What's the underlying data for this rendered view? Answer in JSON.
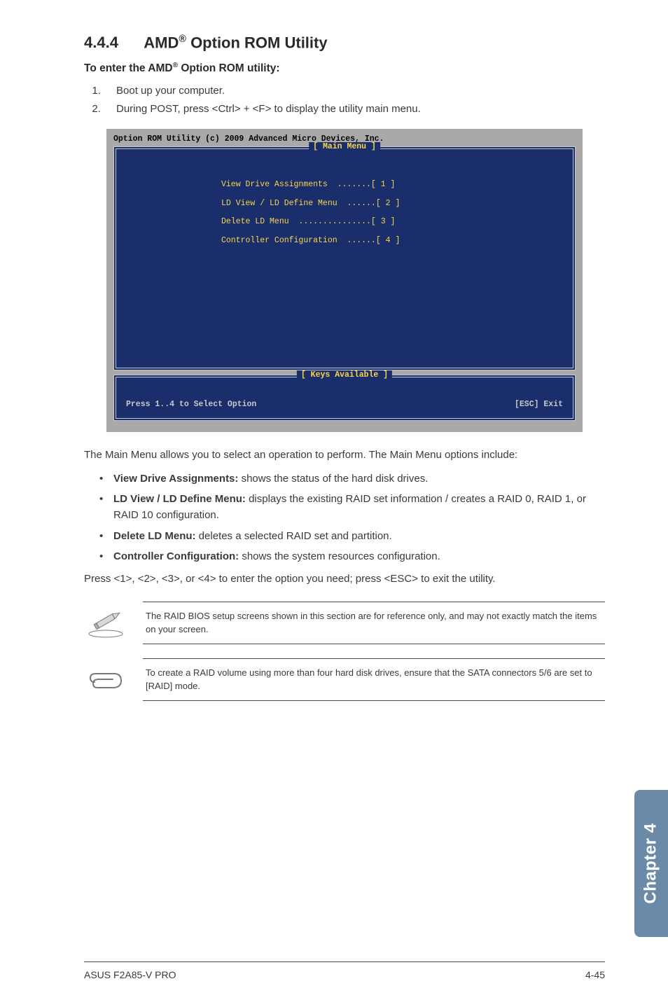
{
  "section": {
    "number": "4.4.4",
    "title_prefix": "AMD",
    "title_sup": "®",
    "title_rest": " Option ROM Utility"
  },
  "subhead_prefix": "To enter the AMD",
  "subhead_sup": "®",
  "subhead_rest": " Option ROM utility:",
  "steps": [
    "Boot up your computer.",
    "During POST, press <Ctrl> + <F> to display the utility main menu."
  ],
  "bios": {
    "header": "Option ROM Utility (c) 2009 Advanced Micro Devices, Inc.",
    "main_label": "[ Main Menu ]",
    "menu": [
      "View Drive Assignments  .......[ 1 ]",
      "LD View / LD Define Menu  ......[ 2 ]",
      "Delete LD Menu  ...............[ 3 ]",
      "Controller Configuration  ......[ 4 ]"
    ],
    "keys_label": "[ Keys Available ]",
    "press_left": "Press 1..4 to Select Option",
    "press_right": "[ESC] Exit"
  },
  "intro_para": "The Main Menu allows you to select an operation to perform. The Main Menu options include:",
  "bullets": [
    {
      "bold": "View Drive Assignments:",
      "rest": " shows the status of the hard disk drives."
    },
    {
      "bold": "LD View / LD Define Menu:",
      "rest": " displays the existing RAID set information / creates a RAID 0, RAID 1, or RAID 10 configuration."
    },
    {
      "bold": "Delete LD Menu:",
      "rest": " deletes a selected RAID set and partition."
    },
    {
      "bold": "Controller Configuration:",
      "rest": " shows the system resources configuration."
    }
  ],
  "press_para": "Press <1>, <2>, <3>, or <4> to enter the option you need; press <ESC> to exit the utility.",
  "notes": [
    "The RAID BIOS setup screens shown in this section are for reference only, and may not exactly match the items on your screen.",
    "To create a RAID volume using more than four hard disk drives, ensure that the SATA connectors 5/6 are set to [RAID] mode."
  ],
  "side_tab": "Chapter 4",
  "footer_left": "ASUS F2A85-V PRO",
  "footer_right": "4-45"
}
